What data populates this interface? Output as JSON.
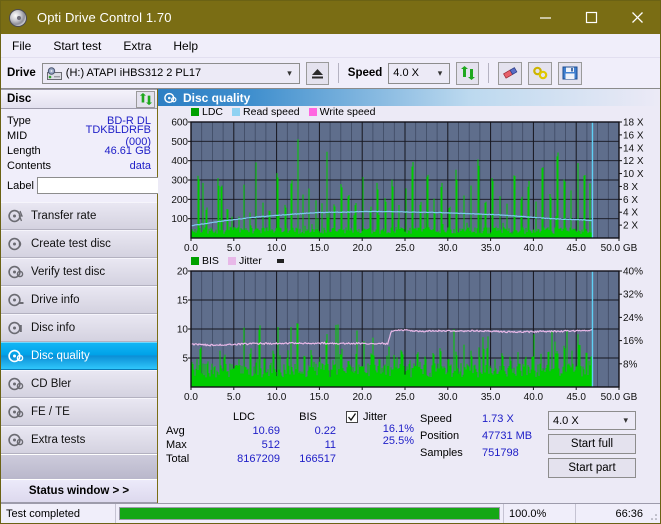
{
  "window": {
    "title": "Opti Drive Control 1.70",
    "app_icon": "disc-icon",
    "minimize": "minimize-icon",
    "maximize": "maximize-icon",
    "close": "close-icon"
  },
  "menu": [
    {
      "label": "File"
    },
    {
      "label": "Start test"
    },
    {
      "label": "Extra"
    },
    {
      "label": "Help"
    }
  ],
  "toolbar": {
    "drive_label": "Drive",
    "drive_value": "(H:)  ATAPI iHBS312  2 PL17",
    "eject_icon": "eject-icon",
    "speed_label": "Speed",
    "speed_value": "4.0 X",
    "refresh_icon": "refresh-icon",
    "eraser_icon": "eraser-icon",
    "chain_icon": "chain-icon",
    "save_icon": "save-icon"
  },
  "disc_panel": {
    "header": "Disc",
    "refresh_icon": "refresh-icon",
    "fields": [
      {
        "key": "Type",
        "value": "BD-R DL"
      },
      {
        "key": "MID",
        "value": "TDKBLDRFB (000)"
      },
      {
        "key": "Length",
        "value": "46.61 GB"
      },
      {
        "key": "Contents",
        "value": "data"
      }
    ],
    "label_key": "Label",
    "label_value": "",
    "label_placeholder": "",
    "disc_button_icon": "cd-icon"
  },
  "sidebar": {
    "items": [
      {
        "label": "Transfer rate",
        "icon": "disc-transfer-icon",
        "active": false
      },
      {
        "label": "Create test disc",
        "icon": "disc-create-icon",
        "active": false
      },
      {
        "label": "Verify test disc",
        "icon": "disc-verify-icon",
        "active": false
      },
      {
        "label": "Drive info",
        "icon": "disc-drive-icon",
        "active": false
      },
      {
        "label": "Disc info",
        "icon": "disc-info-icon",
        "active": false
      },
      {
        "label": "Disc quality",
        "icon": "disc-quality-icon",
        "active": true
      },
      {
        "label": "CD Bler",
        "icon": "disc-bler-icon",
        "active": false
      },
      {
        "label": "FE / TE",
        "icon": "disc-fete-icon",
        "active": false
      },
      {
        "label": "Extra tests",
        "icon": "disc-extra-icon",
        "active": false
      }
    ],
    "status_window_button": "Status window > >"
  },
  "panel": {
    "title": "Disc quality",
    "icon": "disc-quality-icon"
  },
  "stats": {
    "columns": [
      "LDC",
      "BIS"
    ],
    "rows": [
      {
        "label": "Avg",
        "ldc": "10.69",
        "bis": "0.22",
        "jitter": "16.1%"
      },
      {
        "label": "Max",
        "ldc": "512",
        "bis": "11",
        "jitter": "25.5%"
      },
      {
        "label": "Total",
        "ldc": "8167209",
        "bis": "166517",
        "jitter": ""
      }
    ],
    "jitter_label": "Jitter",
    "jitter_checked": true,
    "speed_label": "Speed",
    "speed_value": "1.73 X",
    "position_label": "Position",
    "position_value": "47731 MB",
    "samples_label": "Samples",
    "samples_value": "751798",
    "speed_select": "4.0 X",
    "start_full_button": "Start full",
    "start_part_button": "Start part"
  },
  "statusbar": {
    "message": "Test completed",
    "percent_label": "100.0%",
    "percent_value": 100,
    "elapsed": "66:36"
  },
  "colors": {
    "titlebar": "#7a6d14",
    "accent": "#00a2e8",
    "ldc": "#00c000",
    "read_speed": "#7ec8f0",
    "write_speed": "#ff66e0",
    "bis": "#00a000",
    "jitter": "#e8b8e8",
    "value_text": "#2020c8",
    "plot_bg": "#5f6e8c",
    "progress": "#15a715"
  },
  "chart_data": [
    {
      "type": "line",
      "title": "Disc quality - LDC / Read speed",
      "xlabel": "50.0 GB",
      "ylabel": "LDC",
      "xlim": [
        0,
        50
      ],
      "ylim": [
        0,
        600
      ],
      "y2lim": [
        0,
        18
      ],
      "xticks": [
        "0.0",
        "5.0",
        "10.0",
        "15.0",
        "20.0",
        "25.0",
        "30.0",
        "35.0",
        "40.0",
        "45.0",
        "50.0 GB"
      ],
      "yticks": [
        100,
        200,
        300,
        400,
        500,
        600
      ],
      "y2ticks": [
        "2 X",
        "4 X",
        "6 X",
        "8 X",
        "10 X",
        "12 X",
        "14 X",
        "16 X",
        "18 X"
      ],
      "grid": true,
      "legend": [
        {
          "name": "LDC",
          "color": "#00c000"
        },
        {
          "name": "Read speed",
          "color": "#7ec8f0"
        },
        {
          "name": "Write speed",
          "color": "#ff66e0"
        }
      ],
      "series": [
        {
          "name": "Read speed",
          "color": "#7ec8f0",
          "unit": "X",
          "x": [
            0,
            2,
            4,
            6,
            8,
            10,
            12,
            14,
            16,
            18,
            20,
            22,
            24,
            26,
            28,
            30,
            32,
            34,
            36,
            38,
            40,
            42,
            44,
            46,
            47
          ],
          "values": [
            1.9,
            2.3,
            2.7,
            3.0,
            3.3,
            3.5,
            3.7,
            3.9,
            4.0,
            4.0,
            4.1,
            4.1,
            4.1,
            4.0,
            4.0,
            3.9,
            3.8,
            3.7,
            3.6,
            3.4,
            3.2,
            3.0,
            2.9,
            2.8,
            2.7
          ]
        },
        {
          "name": "LDC",
          "color": "#00c000",
          "note": "dense spike envelope, base ~40, peaks to 512",
          "base": 40,
          "max": 512,
          "peaks": [
            {
              "x": 0.9,
              "y": 340
            },
            {
              "x": 1.4,
              "y": 300
            },
            {
              "x": 1.8,
              "y": 170
            },
            {
              "x": 3.2,
              "y": 310
            },
            {
              "x": 3.6,
              "y": 265
            },
            {
              "x": 4.3,
              "y": 150
            },
            {
              "x": 5.6,
              "y": 120
            },
            {
              "x": 6.2,
              "y": 310
            },
            {
              "x": 6.9,
              "y": 155
            },
            {
              "x": 7.6,
              "y": 400
            },
            {
              "x": 8.4,
              "y": 200
            },
            {
              "x": 9.2,
              "y": 140
            },
            {
              "x": 10.1,
              "y": 345
            },
            {
              "x": 11.0,
              "y": 175
            },
            {
              "x": 11.7,
              "y": 325
            },
            {
              "x": 12.5,
              "y": 510
            },
            {
              "x": 13.1,
              "y": 230
            },
            {
              "x": 13.8,
              "y": 270
            },
            {
              "x": 14.6,
              "y": 190
            },
            {
              "x": 15.3,
              "y": 210
            },
            {
              "x": 15.9,
              "y": 455
            },
            {
              "x": 16.8,
              "y": 180
            },
            {
              "x": 17.6,
              "y": 300
            },
            {
              "x": 18.4,
              "y": 250
            },
            {
              "x": 19.2,
              "y": 200
            },
            {
              "x": 20.1,
              "y": 330
            },
            {
              "x": 21.0,
              "y": 160
            },
            {
              "x": 21.8,
              "y": 280
            },
            {
              "x": 22.7,
              "y": 210
            },
            {
              "x": 23.5,
              "y": 300
            },
            {
              "x": 24.3,
              "y": 180
            },
            {
              "x": 25.1,
              "y": 260
            },
            {
              "x": 25.9,
              "y": 400
            },
            {
              "x": 26.8,
              "y": 190
            },
            {
              "x": 27.6,
              "y": 320
            },
            {
              "x": 28.4,
              "y": 230
            },
            {
              "x": 29.3,
              "y": 280
            },
            {
              "x": 30.2,
              "y": 170
            },
            {
              "x": 31.0,
              "y": 350
            },
            {
              "x": 31.9,
              "y": 220
            },
            {
              "x": 32.7,
              "y": 290
            },
            {
              "x": 33.6,
              "y": 410
            },
            {
              "x": 34.4,
              "y": 200
            },
            {
              "x": 35.2,
              "y": 310
            },
            {
              "x": 36.1,
              "y": 250
            },
            {
              "x": 36.9,
              "y": 180
            },
            {
              "x": 37.8,
              "y": 330
            },
            {
              "x": 38.6,
              "y": 220
            },
            {
              "x": 39.4,
              "y": 290
            },
            {
              "x": 40.3,
              "y": 200
            },
            {
              "x": 41.1,
              "y": 370
            },
            {
              "x": 42.0,
              "y": 240
            },
            {
              "x": 42.8,
              "y": 430
            },
            {
              "x": 43.6,
              "y": 300
            },
            {
              "x": 44.4,
              "y": 260
            },
            {
              "x": 45.2,
              "y": 380
            },
            {
              "x": 46.0,
              "y": 340
            },
            {
              "x": 46.6,
              "y": 300
            }
          ]
        }
      ],
      "marker_x": 46.9,
      "marker_color": "#7ec8f0"
    },
    {
      "type": "line",
      "title": "Disc quality - BIS / Jitter",
      "xlabel": "50.0 GB",
      "ylabel": "BIS",
      "xlim": [
        0,
        50
      ],
      "ylim": [
        0,
        20
      ],
      "y2lim": [
        0,
        40
      ],
      "xticks": [
        "0.0",
        "5.0",
        "10.0",
        "15.0",
        "20.0",
        "25.0",
        "30.0",
        "35.0",
        "40.0",
        "45.0",
        "50.0 GB"
      ],
      "yticks": [
        5,
        10,
        15,
        20
      ],
      "y2ticks": [
        "8%",
        "16%",
        "24%",
        "32%",
        "40%"
      ],
      "grid": true,
      "legend": [
        {
          "name": "BIS",
          "color": "#00a000"
        },
        {
          "name": "Jitter",
          "color": "#e8b8e8"
        }
      ],
      "series": [
        {
          "name": "Jitter",
          "color": "#e8b8e8",
          "unit": "%",
          "x": [
            0,
            2,
            4,
            6,
            8,
            10,
            12,
            14,
            16,
            18,
            20,
            22,
            23,
            23.4,
            25,
            27,
            29,
            31,
            33,
            35,
            37,
            39,
            41,
            43,
            45,
            46.8
          ],
          "values": [
            14.8,
            14.4,
            14.6,
            14.8,
            15.0,
            15.0,
            15.1,
            15.1,
            15.1,
            15.0,
            15.0,
            15.0,
            14.9,
            19.4,
            19.6,
            19.2,
            19.4,
            19.2,
            19.4,
            19.2,
            19.0,
            19.0,
            19.2,
            19.2,
            19.4,
            19.6
          ]
        },
        {
          "name": "BIS",
          "color": "#00a000",
          "note": "dense spike envelope, base ~3, peaks to 11",
          "base": 3,
          "max": 11,
          "peaks": [
            {
              "x": 0.2,
              "y": 4.2
            },
            {
              "x": 1.1,
              "y": 6.8
            },
            {
              "x": 2.0,
              "y": 5.0
            },
            {
              "x": 3.4,
              "y": 6.5
            },
            {
              "x": 3.9,
              "y": 6.0
            },
            {
              "x": 4.8,
              "y": 4.6
            },
            {
              "x": 5.6,
              "y": 5.2
            },
            {
              "x": 6.9,
              "y": 6.4
            },
            {
              "x": 7.7,
              "y": 5.0
            },
            {
              "x": 8.6,
              "y": 4.8
            },
            {
              "x": 9.6,
              "y": 6.6
            },
            {
              "x": 10.4,
              "y": 5.4
            },
            {
              "x": 11.3,
              "y": 4.9
            },
            {
              "x": 12.4,
              "y": 11.0
            },
            {
              "x": 13.2,
              "y": 5.6
            },
            {
              "x": 14.1,
              "y": 6.2
            },
            {
              "x": 15.0,
              "y": 5.0
            },
            {
              "x": 15.8,
              "y": 9.0
            },
            {
              "x": 16.6,
              "y": 5.4
            },
            {
              "x": 17.5,
              "y": 6.0
            },
            {
              "x": 18.4,
              "y": 4.8
            },
            {
              "x": 19.3,
              "y": 5.8
            },
            {
              "x": 20.2,
              "y": 5.2
            },
            {
              "x": 21.1,
              "y": 6.3
            },
            {
              "x": 22.0,
              "y": 5.0
            },
            {
              "x": 22.9,
              "y": 6.0
            },
            {
              "x": 23.8,
              "y": 5.4
            },
            {
              "x": 24.7,
              "y": 6.2
            },
            {
              "x": 25.6,
              "y": 5.0
            },
            {
              "x": 26.5,
              "y": 6.6
            },
            {
              "x": 27.4,
              "y": 5.2
            },
            {
              "x": 28.3,
              "y": 5.9
            },
            {
              "x": 29.2,
              "y": 6.4
            },
            {
              "x": 30.1,
              "y": 5.1
            },
            {
              "x": 31.0,
              "y": 6.0
            },
            {
              "x": 31.9,
              "y": 5.5
            },
            {
              "x": 32.8,
              "y": 6.2
            },
            {
              "x": 33.7,
              "y": 5.0
            },
            {
              "x": 34.6,
              "y": 6.8
            },
            {
              "x": 35.5,
              "y": 5.6
            },
            {
              "x": 36.4,
              "y": 6.0
            },
            {
              "x": 37.3,
              "y": 5.2
            },
            {
              "x": 38.2,
              "y": 6.4
            },
            {
              "x": 39.1,
              "y": 5.4
            },
            {
              "x": 40.0,
              "y": 6.0
            },
            {
              "x": 40.9,
              "y": 5.8
            },
            {
              "x": 41.8,
              "y": 6.6
            },
            {
              "x": 42.7,
              "y": 6.2
            },
            {
              "x": 43.6,
              "y": 7.0
            },
            {
              "x": 44.5,
              "y": 6.4
            },
            {
              "x": 45.4,
              "y": 7.2
            },
            {
              "x": 46.2,
              "y": 6.8
            },
            {
              "x": 46.8,
              "y": 6.0
            }
          ]
        }
      ],
      "marker_x": 46.9,
      "marker_color": "#7ec8f0"
    }
  ]
}
